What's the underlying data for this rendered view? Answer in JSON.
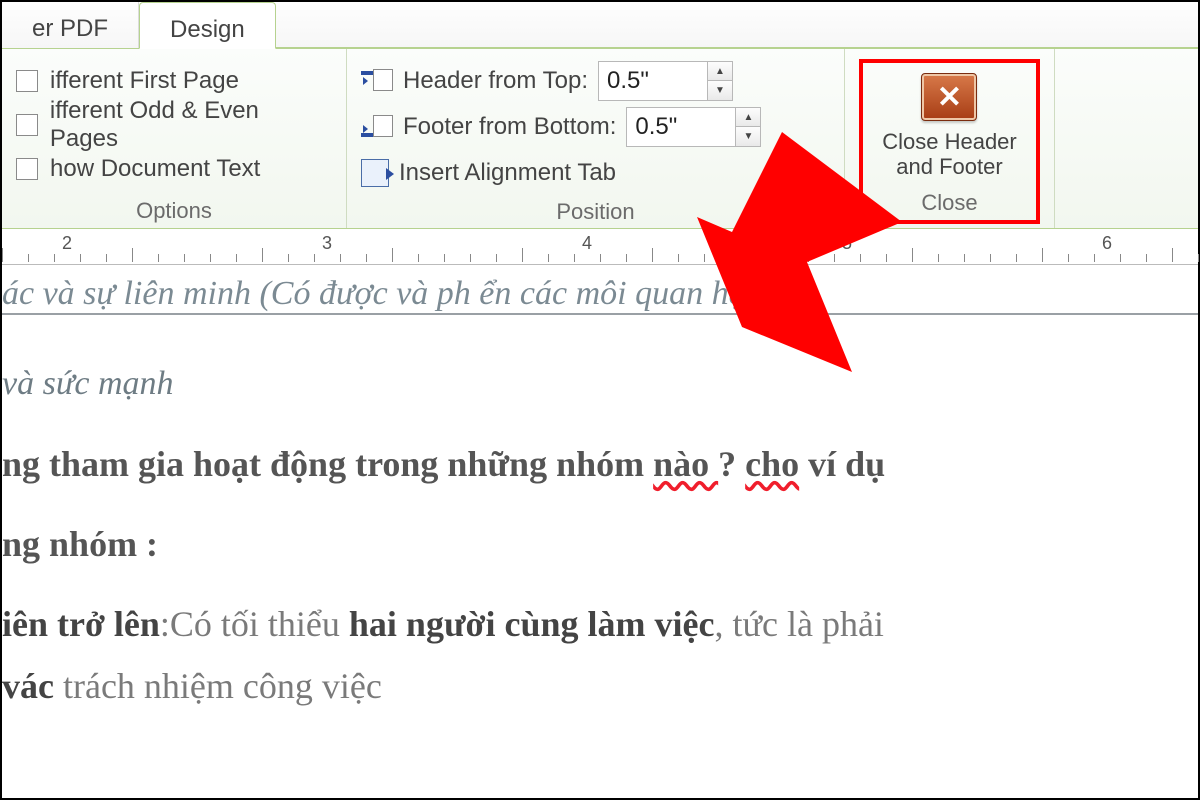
{
  "tabs": {
    "pdf": "er PDF",
    "design": "Design"
  },
  "options_group": {
    "label": "Options",
    "first_page": "ifferent First Page",
    "odd_even": "ifferent Odd & Even Pages",
    "show_doc": "how Document Text"
  },
  "position_group": {
    "label": "Position",
    "header_from_top": "Header from Top:",
    "footer_from_bottom": "Footer from Bottom:",
    "insert_alignment_tab": "Insert Alignment Tab",
    "header_value": "0.5\"",
    "footer_value": "0.5\""
  },
  "close_group": {
    "label": "Close",
    "button_line1": "Close Header",
    "button_line2": "and Footer"
  },
  "ruler": {
    "n2": "2",
    "n3": "3",
    "n4": "4",
    "n5": "5",
    "n6": "6"
  },
  "document": {
    "header_italic": "ác và sự liên minh (Có được và ph        ển các môi quan hệ xã",
    "italic2": "và sức mạnh",
    "bold1_a": "ng tham gia hoạt động trong những nhóm ",
    "bold1_wavy": "nào ",
    "bold1_b": "? ",
    "bold1_wavy2": "cho",
    "bold1_c": " ví dụ",
    "bold2": "ng nhóm :",
    "line3_bold1": "iên trở lên",
    "line3_mid": ":Có tối thiểu ",
    "line3_bold2": "hai người cùng làm việc",
    "line3_end": ", tức là phải",
    "line4_bold": "vác",
    "line4_rest": " trách nhiệm công việc"
  }
}
